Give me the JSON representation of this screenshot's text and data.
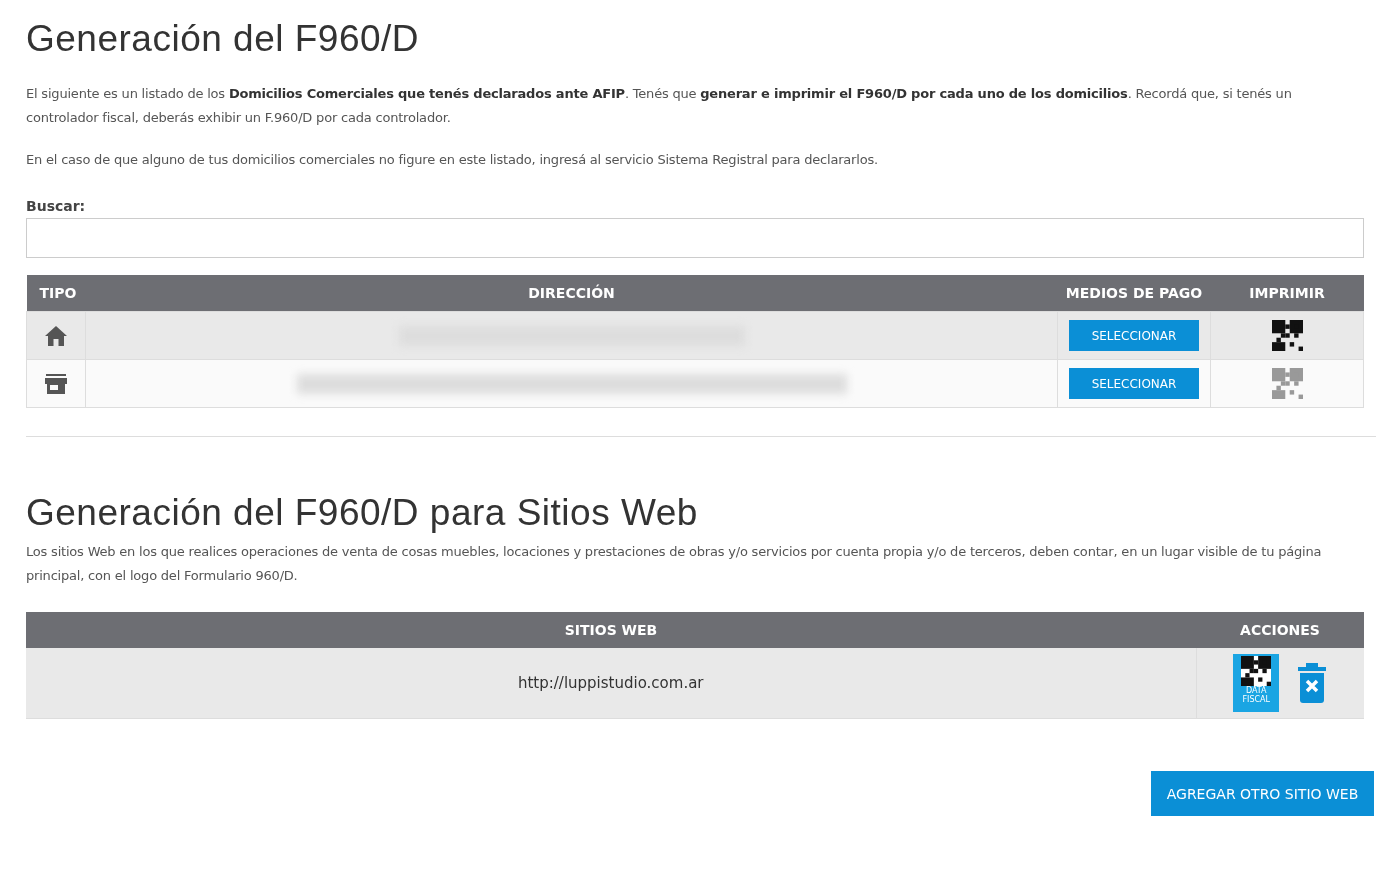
{
  "title": "Generación del F960/D",
  "intro": [
    "El siguiente es un listado de los **Domicilios Comerciales que tenés declarados ante AFIP**. Tenés que **generar e imprimir el F960/D por cada uno de los domicilios**. Recordá que, si tenés un controlador fiscal, deberás exhibir un F.960/D por cada controlador.",
    "En el caso de que alguno de tus domicilios comerciales no figure en este listado, ingresá al servicio Sistema Registral para declararlos."
  ],
  "search": {
    "label": "Buscar:"
  },
  "table": {
    "columns": [
      "TIPO",
      "DIRECCIÓN",
      "MEDIOS DE PAGO",
      "IMPRIMIR"
    ],
    "rows": [
      {
        "kind": "home",
        "button": "SELECCIONAR",
        "print_disabled": false
      },
      {
        "kind": "store",
        "button": "SELECCIONAR",
        "print_disabled": true
      }
    ]
  },
  "web": {
    "title": "Generación del F960/D para Sitios Web",
    "text": "Los sitios Web en los que realices operaciones de venta de cosas muebles, locaciones y prestaciones de obras y/o servicios por cuenta propia y/o de terceros, deben contar, en un lugar visible de tu página principal, con el logo del Formulario 960/D.",
    "columns": [
      "SITIOS WEB",
      "ACCIONES"
    ],
    "rows": [
      {
        "url": "http://luppistudio.com.ar",
        "logo_text": [
          "DATA",
          "FISCAL"
        ]
      }
    ],
    "add_button": "AGREGAR OTRO SITIO WEB"
  }
}
